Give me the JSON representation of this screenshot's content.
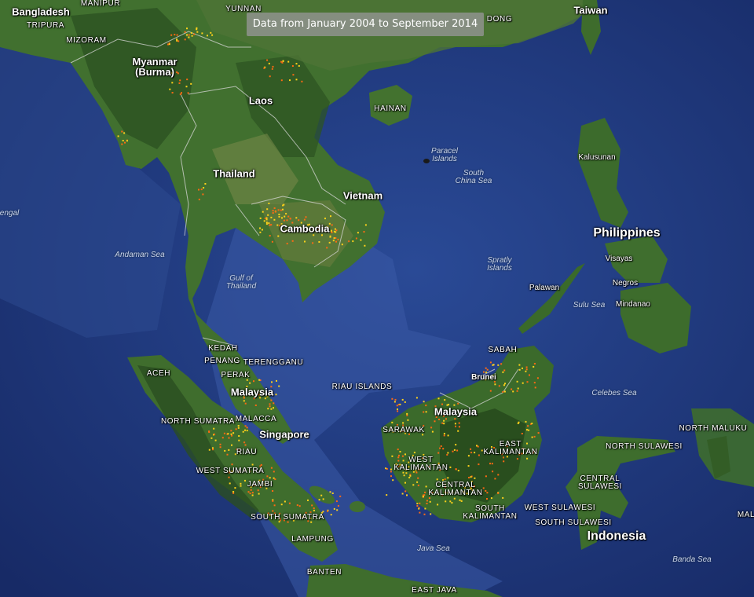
{
  "banner": {
    "text": "Data from January 2004 to September 2014"
  },
  "colors": {
    "ocean": "#23408a",
    "ocean_deep": "#1b3170",
    "land": "#3e6a2e",
    "land_dark": "#26481e",
    "land_light": "#6f8a4a",
    "border": "#d8d8d8",
    "fire_hot": "#ffd21a",
    "fire": "#ff6a13"
  },
  "labels": {
    "bangladesh": "Bangladesh",
    "manipur": "MANIPUR",
    "tripura": "TRIPURA",
    "mizoram": "MIZORAM",
    "yunnan": "YUNNAN",
    "guangdong": "DONG",
    "taiwan": "Taiwan",
    "myanmar": "Myanmar\n(Burma)",
    "laos": "Laos",
    "hainan": "HAINAN",
    "thailand": "Thailand",
    "vietnam": "Vietnam",
    "cambodia": "Cambodia",
    "paracel": "Paracel\nIslands",
    "south_china_sea": "South\nChina Sea",
    "kalusunan": "Kalusunan",
    "philippines": "Philippines",
    "visayas": "Visayas",
    "negros": "Negros",
    "mindanao": "Mindanao",
    "palawan": "Palawan",
    "sulu_sea": "Sulu Sea",
    "spratly": "Spratly\nIslands",
    "andaman_sea": "Andaman Sea",
    "gulf_thailand": "Gulf of\nThailand",
    "bengal": "engal",
    "kedah": "KEDAH",
    "penang": "PENANG",
    "terengganu": "TERENGGANU",
    "perak": "PERAK",
    "malaysia_w": "Malaysia",
    "aceh": "ACEH",
    "riau_islands": "RIAU ISLANDS",
    "north_sumatra": "NORTH SUMATRA",
    "malacca": "MALACCA",
    "singapore": "Singapore",
    "riau": "RIAU",
    "west_sumatra": "WEST SUMATRA",
    "jambi": "JAMBI",
    "south_sumatra": "SOUTH SUMATRA",
    "lampung": "LAMPUNG",
    "banten": "BANTEN",
    "east_java": "EAST JAVA",
    "java_sea": "Java Sea",
    "sabah": "SABAH",
    "brunei": "Brunei",
    "malaysia_e": "Malaysia",
    "sarawak": "SARAWAK",
    "west_kalimantan": "WEST\nKALIMANTAN",
    "east_kalimantan": "EAST\nKALIMANTAN",
    "central_kalimantan": "CENTRAL\nKALIMANTAN",
    "south_kalimantan": "SOUTH\nKALIMANTAN",
    "celebes_sea": "Celebes Sea",
    "north_maluku": "NORTH MALUKU",
    "north_sulawesi": "NORTH SULAWESI",
    "central_sulawesi": "CENTRAL\nSULAWESI",
    "west_sulawesi": "WEST SULAWESI",
    "south_sulawesi": "SOUTH SULAWESI",
    "indonesia": "Indonesia",
    "banda_sea": "Banda Sea",
    "maluku_edge": "MAL"
  }
}
